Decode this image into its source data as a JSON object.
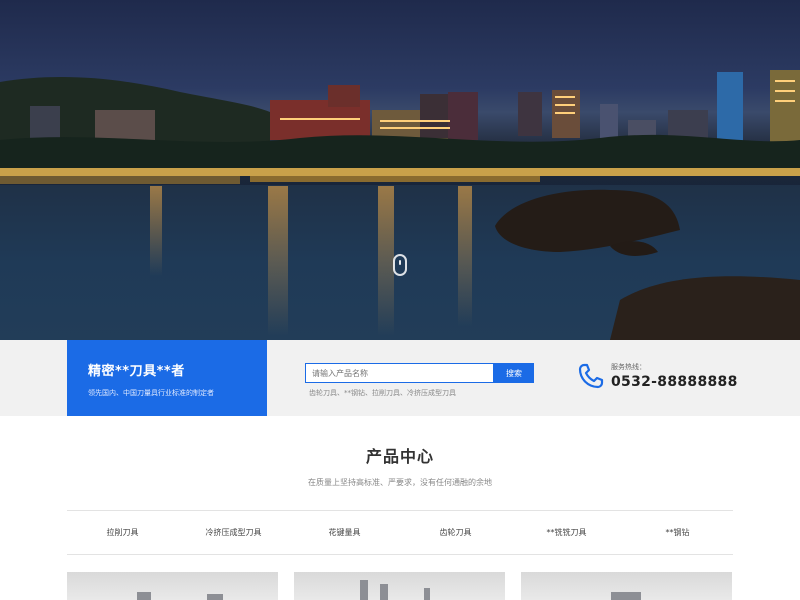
{
  "brand": {
    "title": "精密**刀具**者",
    "subtitle": "领先国内、中国刀量具行业标准的制定者"
  },
  "search": {
    "placeholder": "请输入产品名称",
    "button_label": "搜索",
    "hot_keywords": "齿轮刀具、**钢钻、拉削刀具、冷挤压成型刀具"
  },
  "hotline": {
    "label": "服务热线：",
    "number": "0532-88888888"
  },
  "products": {
    "title": "产品中心",
    "subtitle": "在质量上坚持高标准、严要求，没有任何通融的余地",
    "categories": [
      "拉削刀具",
      "冷挤压成型刀具",
      "花键量具",
      "齿轮刀具",
      "**铣铣刀具",
      "**钢钻"
    ]
  },
  "icons": {
    "scroll": "mouse-scroll-icon",
    "phone": "phone-icon"
  },
  "colors": {
    "accent": "#1b6be6",
    "bar_background": "#f1f1f1"
  }
}
